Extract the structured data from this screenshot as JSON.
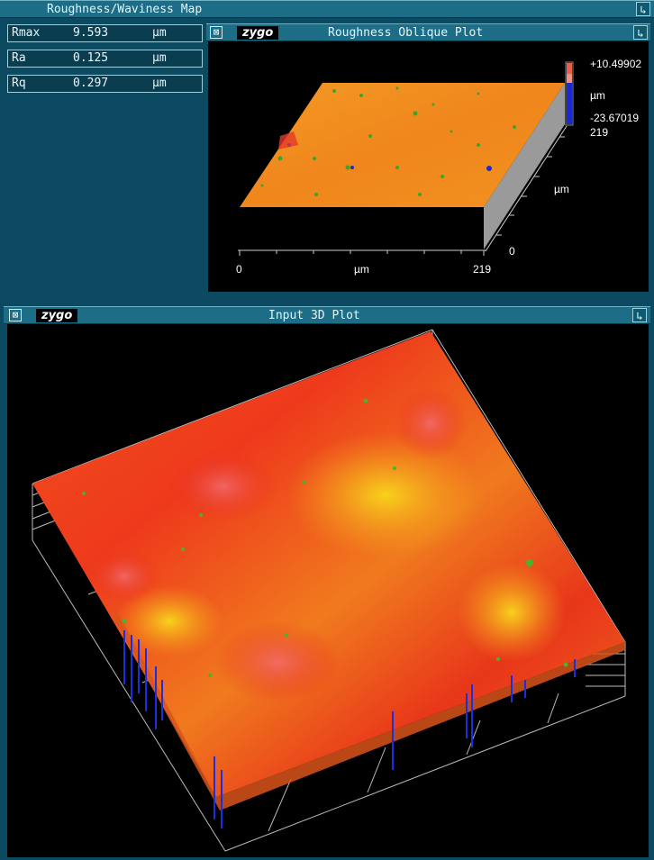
{
  "map_window": {
    "title": "Roughness/Waviness Map",
    "stats": [
      {
        "label": "Rmax",
        "value": "9.593",
        "unit": "µm"
      },
      {
        "label": "Ra",
        "value": "0.125",
        "unit": "µm"
      },
      {
        "label": "Rq",
        "value": "0.297",
        "unit": "µm"
      }
    ]
  },
  "oblique_window": {
    "title": "Roughness Oblique Plot",
    "logo": "zygo",
    "scale_max": "+10.49902",
    "scale_unit": "µm",
    "scale_min": "-23.67019",
    "y_axis_max": "219",
    "y_axis_unit": "µm",
    "y_axis_min": "0",
    "x_axis_min": "0",
    "x_axis_unit": "µm",
    "x_axis_max": "219"
  },
  "input_window": {
    "title": "Input 3D Plot",
    "logo": "zygo"
  },
  "colors": {
    "window_bg": "#0b4a61",
    "titlebar": "#1d6d86",
    "surface_orange": "#f28a1f",
    "surface_red": "#e8281a",
    "surface_yellow": "#f5d21a",
    "spike_blue": "#1428d8"
  },
  "icons": {
    "close": "close-box-icon",
    "menu": "window-menu-icon"
  }
}
